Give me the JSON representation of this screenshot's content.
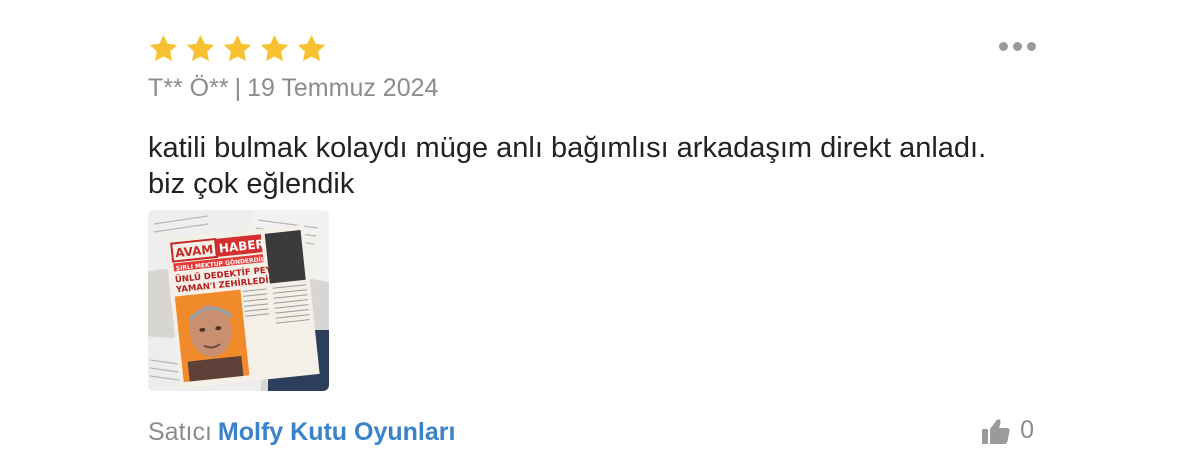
{
  "review": {
    "rating": 5,
    "max_rating": 5,
    "author": "T** Ö**",
    "separator": "|",
    "date": "19 Temmuz 2024",
    "comment": "katili bulmak kolaydı müge anlı bağımlısı arkadaşım direkt anladı.\nbiz çok eğlendik",
    "photo": {
      "masthead": "AVAM HABER",
      "headline_lines": [
        "ŞIRLI MEKTUP GÖNDERDİLER",
        "ÜNLÜ DEDEKTİF PEYAMİ",
        "YAMAN'I ZEHİRLEDİLER!"
      ]
    },
    "seller_label": "Satıcı",
    "seller_name": "Molfy Kutu Oyunları",
    "helpful_count": "0",
    "colors": {
      "star": "#f7c130",
      "seller_link": "#3a82c9",
      "muted_text": "#8c8c8c",
      "icon_gray": "#9a9a9a"
    },
    "icons": {
      "rating": "star-icon",
      "menu": "more-options-icon",
      "helpful": "thumbs-up-icon"
    }
  }
}
